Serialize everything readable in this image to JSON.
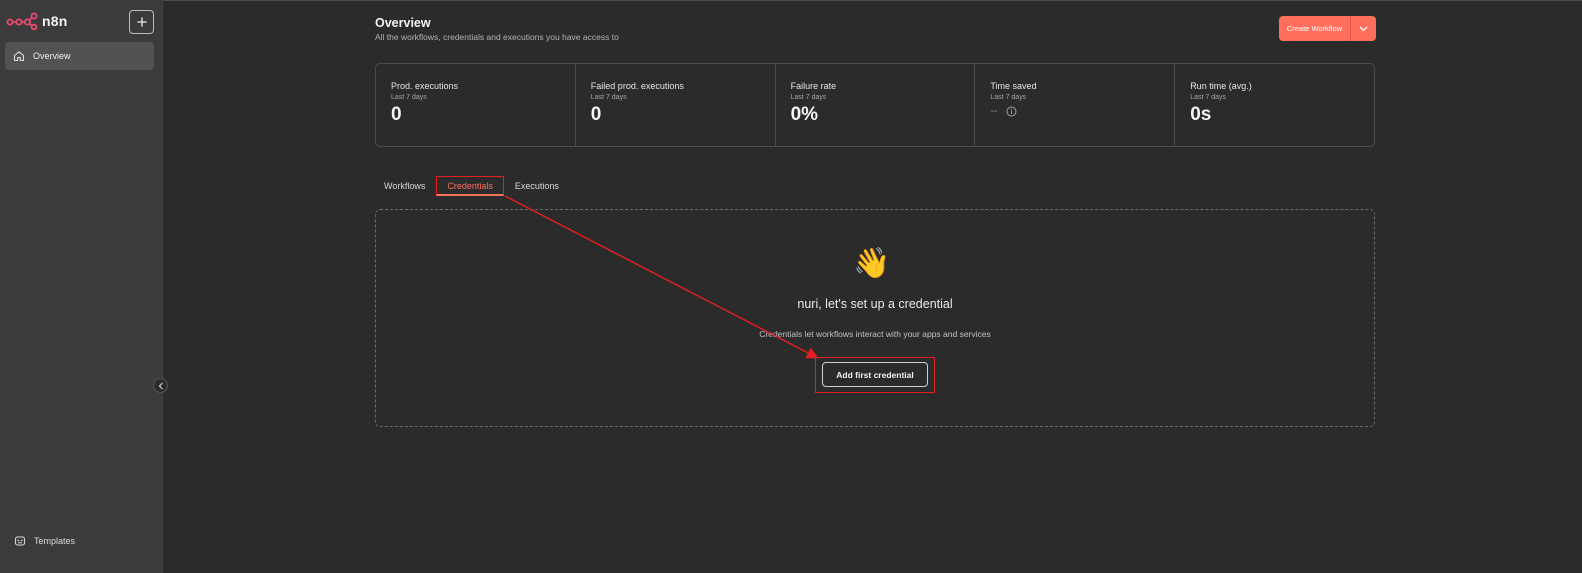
{
  "sidebar": {
    "logo_text": "n8n",
    "new_button_icon": "plus-icon",
    "nav": {
      "overview_label": "Overview",
      "templates_label": "Templates"
    }
  },
  "header": {
    "title": "Overview",
    "subtitle": "All the workflows, credentials and executions you have access to",
    "create_button_label": "Create Workflow"
  },
  "stats": [
    {
      "label": "Prod. executions",
      "period": "Last 7 days",
      "value": "0"
    },
    {
      "label": "Failed prod. executions",
      "period": "Last 7 days",
      "value": "0"
    },
    {
      "label": "Failure rate",
      "period": "Last 7 days",
      "value": "0%"
    },
    {
      "label": "Time saved",
      "period": "Last 7 days",
      "value": "--"
    },
    {
      "label": "Run time (avg.)",
      "period": "Last 7 days",
      "value": "0s"
    }
  ],
  "tabs": [
    {
      "label": "Workflows",
      "active": false
    },
    {
      "label": "Credentials",
      "active": true
    },
    {
      "label": "Executions",
      "active": false
    }
  ],
  "empty_state": {
    "emoji": "👋",
    "title": "nuri, let's set up a credential",
    "description": "Credentials let workflows interact with your apps and services",
    "button_label": "Add first credential"
  },
  "colors": {
    "accent": "#ff6f5c",
    "background": "#2b2b2b",
    "sidebar": "#3b3b3b",
    "annotation": "#e02020"
  }
}
